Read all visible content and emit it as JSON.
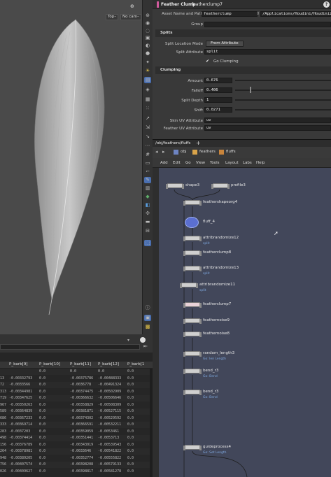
{
  "viewport": {
    "top_button": "Top–",
    "cam_button": "No cam–"
  },
  "params": {
    "node_type": "Feather Clump",
    "node_name": "featherclump7",
    "asset_label": "Asset Name and Path",
    "asset_name": "featherclump",
    "asset_path": "/Applications/Houdini/Houdini20.0.",
    "group_label": "Group",
    "splits_header": "Splits",
    "split_mode_label": "Split Location Mode",
    "split_mode_value": "From Attribute",
    "split_attr_label": "Split Attribute",
    "split_attr_value": "split",
    "go_clumping_label": "Go Clumping",
    "clumping_header": "Clumping",
    "amount_label": "Amount",
    "amount_value": "0.676",
    "falloff_label": "Falloff",
    "falloff_value": "0.406",
    "split_depth_label": "Split Depth",
    "split_depth_value": "1",
    "shift_label": "Shift",
    "shift_value": "0.0271",
    "skin_uv_label": "Skin UV Attribute",
    "skin_uv_value": "uv",
    "feather_uv_label": "Feather UV Attribute",
    "feather_uv_value": "uv"
  },
  "network": {
    "tab_label": "/obj/feathers/fluffs",
    "path_obj": "obj",
    "path_feathers": "feathers",
    "path_fluffs": "fluffs",
    "menu": [
      "Add",
      "Edit",
      "Go",
      "View",
      "Tools",
      "Layout",
      "Labs",
      "Help"
    ],
    "nodes": [
      {
        "name": "shape3",
        "sub": ""
      },
      {
        "name": "profile3",
        "sub": ""
      },
      {
        "name": "feathershapeorg4",
        "sub": ""
      },
      {
        "name": "fluff_4",
        "sub": ""
      },
      {
        "name": "attribrandomize12",
        "sub": "split"
      },
      {
        "name": "featherclump8",
        "sub": ""
      },
      {
        "name": "attribrandomize13",
        "sub": "split"
      },
      {
        "name": "attribrandomize11",
        "sub": "split"
      },
      {
        "name": "featherclump7",
        "sub": ""
      },
      {
        "name": "feathernoise9",
        "sub": ""
      },
      {
        "name": "feathernoise8",
        "sub": ""
      },
      {
        "name": "random_length3",
        "sub": "Go: len Length"
      },
      {
        "name": "bend_r3",
        "sub": "Go: Bend"
      },
      {
        "name": "bend_r3",
        "sub": "Go: Bend"
      },
      {
        "name": "guideprocess4",
        "sub": "Go: Set Length"
      }
    ]
  },
  "spreadsheet": {
    "columns": [
      "P_barb[9]",
      "P_barb[10]",
      "P_barb[11]",
      "P_barb[12]",
      "P_barb[1"
    ],
    "rows": [
      [
        "",
        "0.0",
        "0.0",
        "0.0",
        "0.0"
      ],
      [
        "13",
        "-0.00332793",
        "0.0",
        "-0.00375786",
        "-0.00488333",
        "0.0"
      ],
      [
        "72",
        "-0.0033566",
        "0.0",
        "-0.0036778",
        "-0.00491324",
        "0.0"
      ],
      [
        "313",
        "-0.00344981",
        "0.0",
        "-0.00374475",
        "-0.00502909",
        "0.0"
      ],
      [
        "719",
        "-0.00347625",
        "0.0",
        "-0.00366632",
        "-0.00506646",
        "0.0"
      ],
      [
        "967",
        "-0.00350263",
        "0.0",
        "-0.00358829",
        "-0.00508309",
        "0.0"
      ],
      [
        "589",
        "-0.00364839",
        "0.0",
        "-0.00381871",
        "-0.00527115",
        "0.0"
      ],
      [
        "686",
        "-0.00367233",
        "0.0",
        "-0.00374302",
        "-0.00529592",
        "0.0"
      ],
      [
        "333",
        "-0.00369714",
        "0.0",
        "-0.00366591",
        "-0.00532211",
        "0.0"
      ],
      [
        "283",
        "-0.0037203",
        "0.0",
        "-0.00359059",
        "-0.0053461",
        "0.0"
      ],
      [
        "498",
        "-0.00374414",
        "0.0",
        "-0.00351441",
        "-0.0053713",
        "0.0"
      ],
      [
        "156",
        "-0.00376789",
        "0.0",
        "-0.00343019",
        "-0.00539543",
        "0.0"
      ],
      [
        "264",
        "-0.00378981",
        "0.0",
        "-0.0033646",
        "-0.00541822",
        "0.0"
      ],
      [
        "948",
        "-0.00389205",
        "0.0",
        "-0.00352774",
        "-0.00555822",
        "0.0"
      ],
      [
        "756",
        "-0.00407574",
        "0.0",
        "-0.00398208",
        "-0.00579133",
        "0.0"
      ],
      [
        "026",
        "-0.00409627",
        "0.0",
        "-0.00398817",
        "-0.00581278",
        "0.0"
      ]
    ]
  },
  "colors": {
    "network_bg": "#42475a",
    "node_body": "#cfcfcf",
    "wire": "#222222",
    "selected_node": "#5b6fd0",
    "sub_label": "#7fa9e0"
  }
}
